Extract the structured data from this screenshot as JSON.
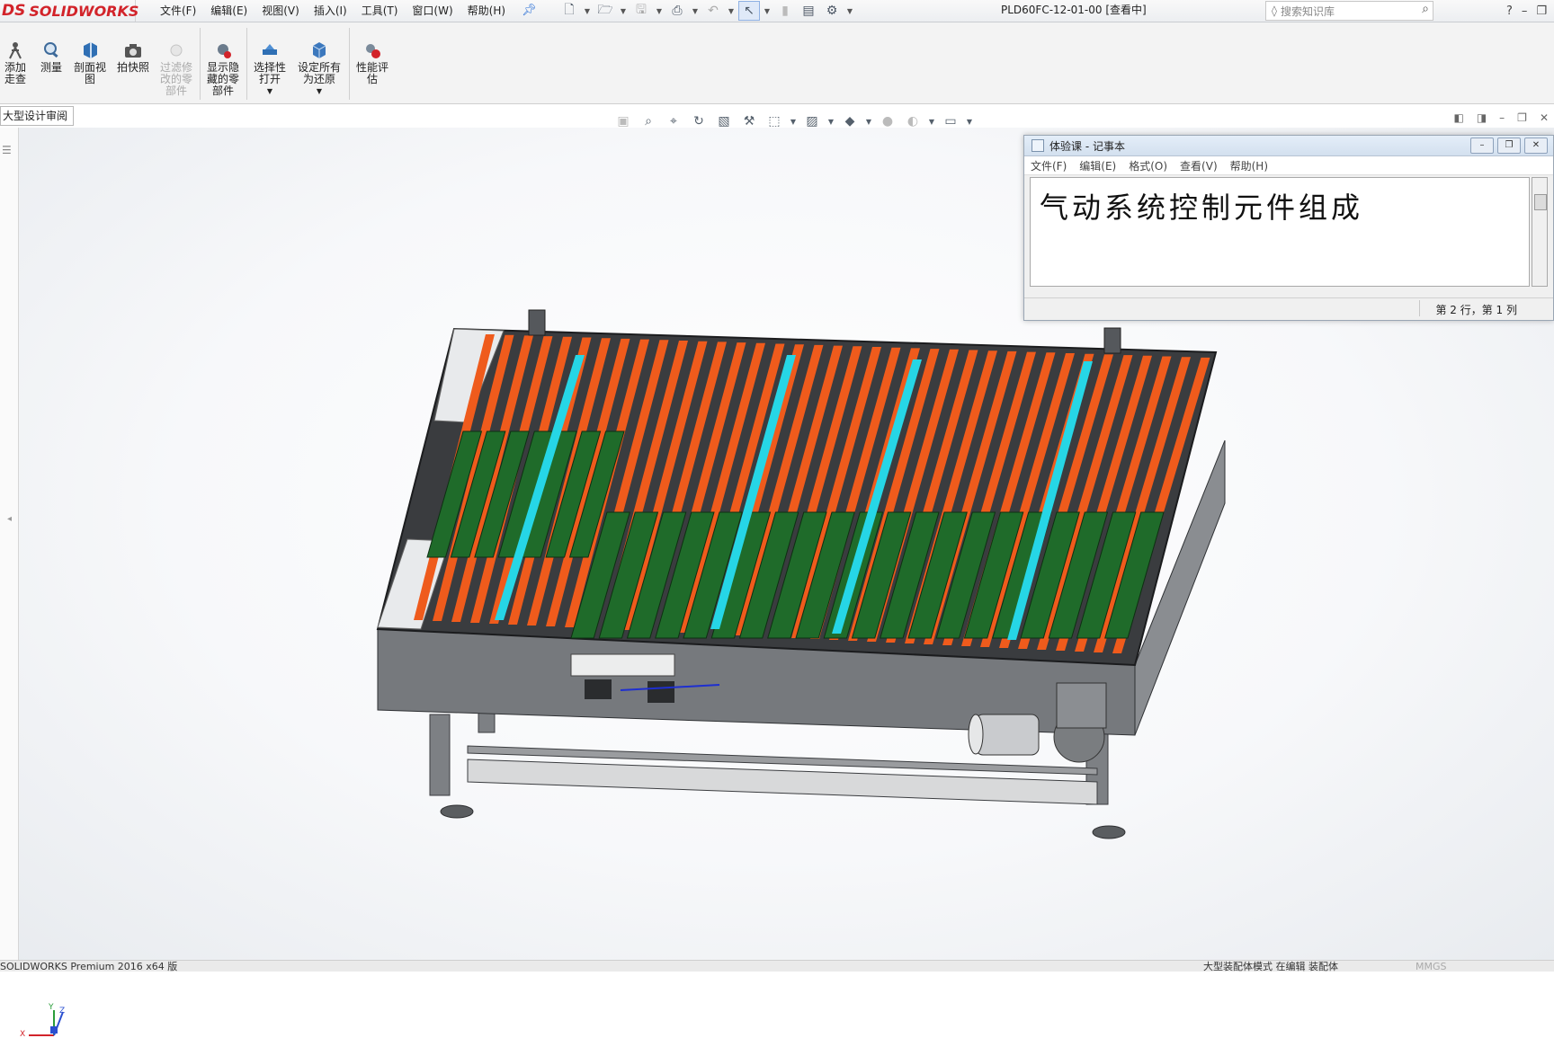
{
  "app": {
    "logo_text": "SOLIDWORKS",
    "logo_prefix": "DS",
    "document_title": "PLD60FC-12-01-00 [查看中]"
  },
  "menu": [
    {
      "label": "文件(F)"
    },
    {
      "label": "编辑(E)"
    },
    {
      "label": "视图(V)"
    },
    {
      "label": "插入(I)"
    },
    {
      "label": "工具(T)"
    },
    {
      "label": "窗口(W)"
    },
    {
      "label": "帮助(H)"
    }
  ],
  "search": {
    "placeholder": "搜索知识库"
  },
  "command_manager": {
    "add_walkthrough": "添加走查",
    "measure": "测量",
    "section_view": "剖面视图",
    "snapshot": "拍快照",
    "filter_modified": "过滤修改的零部件",
    "show_hidden": "显示隐藏的零部件",
    "selective_open": "选择性打开",
    "set_all_restore": "设定所有为还原",
    "performance_eval": "性能评估"
  },
  "tab": {
    "label": "大型设计审阅"
  },
  "notepad": {
    "title": "体验课 - 记事本",
    "menu": [
      "文件(F)",
      "编辑(E)",
      "格式(O)",
      "查看(V)",
      "帮助(H)"
    ],
    "content": "气动系统控制元件组成",
    "status": "第 2 行，第 1 列"
  },
  "triad": {
    "x": "X",
    "y": "Y",
    "z": "Z"
  },
  "statusbar": {
    "left": "SOLIDWORKS Premium 2016 x64 版",
    "right": "大型装配体模式  在编辑 装配体",
    "units": "MMGS"
  },
  "colors": {
    "rollers": "#ef5b1c",
    "modules": "#1f6b2a",
    "frame": "#6a6d70",
    "accent": "#d2232a"
  }
}
